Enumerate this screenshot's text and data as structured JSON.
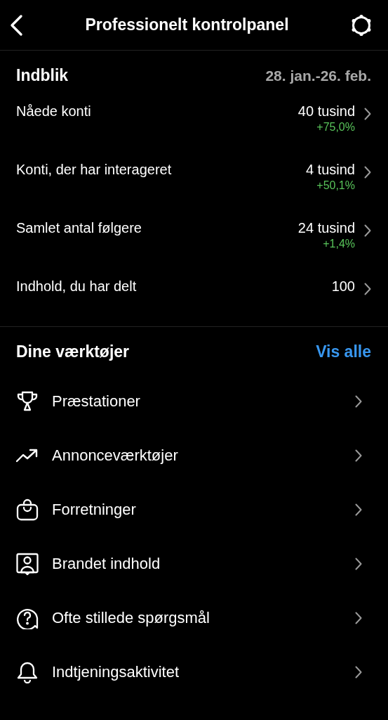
{
  "header": {
    "title": "Professionelt kontrolpanel"
  },
  "insights": {
    "title": "Indblik",
    "date_range": "28. jan.-26. feb.",
    "rows": [
      {
        "label": "Nåede konti",
        "value": "40 tusind",
        "change": "+75,0%"
      },
      {
        "label": "Konti, der har interageret",
        "value": "4 tusind",
        "change": "+50,1%"
      },
      {
        "label": "Samlet antal følgere",
        "value": "24 tusind",
        "change": "+1,4%"
      },
      {
        "label": "Indhold, du har delt",
        "value": "100"
      }
    ]
  },
  "tools": {
    "title": "Dine værktøjer",
    "link": "Vis alle",
    "items": [
      {
        "kind": "trophy",
        "label": "Præstationer"
      },
      {
        "kind": "trend",
        "label": "Annonceværktøjer"
      },
      {
        "kind": "bag",
        "label": "Forretninger"
      },
      {
        "kind": "person",
        "label": "Brandet indhold"
      },
      {
        "kind": "question",
        "label": "Ofte stillede spørgsmål"
      },
      {
        "kind": "bell",
        "label": "Indtjeningsaktivitet"
      }
    ]
  }
}
